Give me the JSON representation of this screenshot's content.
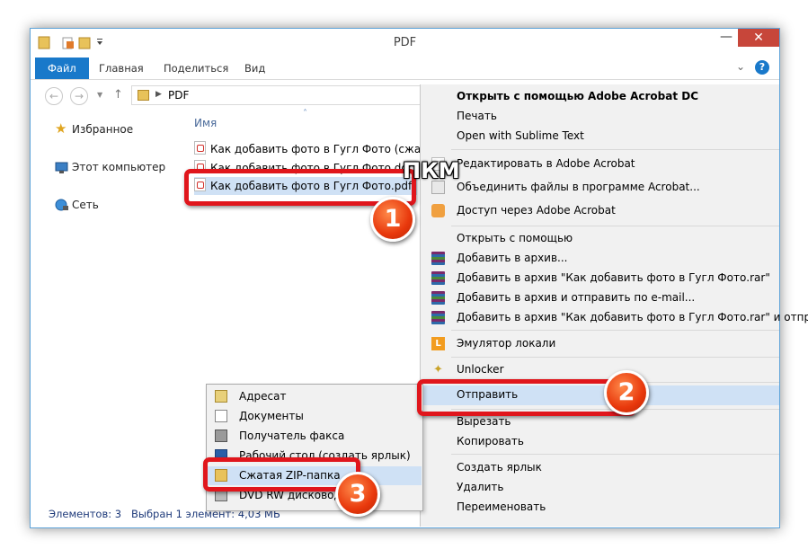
{
  "window": {
    "title": "PDF",
    "close_glyph": "✕",
    "minimize_glyph": "—"
  },
  "ribbon": {
    "tabs": [
      "Файл",
      "Главная",
      "Поделиться",
      "Вид"
    ],
    "help_glyph": "?",
    "expand_glyph": "⌄"
  },
  "address": {
    "back_glyph": "←",
    "forward_glyph": "→",
    "up_glyph": "↑",
    "path": "PDF",
    "dropdown_glyph": "⌄"
  },
  "nav": {
    "items": [
      "Избранное",
      "Этот компьютер",
      "Сеть"
    ]
  },
  "content": {
    "column_name": "Имя",
    "sort_glyph": "˄",
    "files": [
      "Как добавить фото в Гугл Фото (сжаты...",
      "Как добавить фото в Гугл Фото.docx",
      "Как добавить фото в Гугл Фото.pdf"
    ]
  },
  "status": {
    "count": "Элементов: 3",
    "selected": "Выбран 1 элемент: 4,03 МБ"
  },
  "context_menu": {
    "open_with_acrobat": "Открыть с помощью Adobe Acrobat DC",
    "print": "Печать",
    "open_sublime": "Open with Sublime Text",
    "edit_acrobat": "Редактировать в Adobe Acrobat",
    "combine_acrobat": "Объединить файлы в программе Acrobat...",
    "access_acrobat": "Доступ через Adobe Acrobat",
    "open_with": "Открыть с помощью",
    "add_archive": "Добавить в архив...",
    "add_rar": "Добавить в архив \"Как добавить фото в Гугл Фото.rar\"",
    "add_email": "Добавить в архив и отправить по e-mail...",
    "add_rar_email": "Добавить в архив \"Как добавить фото в Гугл Фото.rar\" и отправит",
    "locale_emulator": "Эмулятор локали",
    "locale_letter": "L",
    "unlocker": "Unlocker",
    "send_to": "Отправить",
    "cut": "Вырезать",
    "copy": "Копировать",
    "shortcut": "Создать ярлык",
    "delete": "Удалить",
    "rename": "Переименовать"
  },
  "submenu": {
    "items": [
      "Адресат",
      "Документы",
      "Получатель факса",
      "Рабочий стол (создать ярлык)",
      "Сжатая ZIP-папка",
      "DVD RW дисковод (F:)"
    ]
  },
  "annotations": {
    "pkm": "ПКМ",
    "step1": "1",
    "step2": "2",
    "step3": "3"
  },
  "colors": {
    "accent": "#1979ca",
    "annotation_red": "#e0161c",
    "close_red": "#c7463a",
    "highlight": "#cfe1f5"
  }
}
